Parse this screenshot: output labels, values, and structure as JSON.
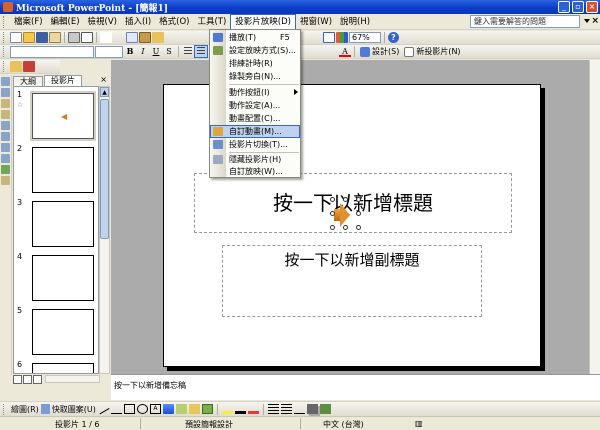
{
  "window": {
    "title": "Microsoft PowerPoint - [簡報1]",
    "minimize": "_",
    "restore": "▫",
    "close": "×"
  },
  "menubar": {
    "items": [
      "檔案(F)",
      "編輯(E)",
      "檢視(V)",
      "插入(I)",
      "格式(O)",
      "工具(T)",
      "投影片放映(D)",
      "視窗(W)",
      "說明(H)"
    ],
    "help_placeholder": "鍵入需要解答的問題",
    "close_doc": "×"
  },
  "toolbar_standard": {
    "zoom": "67%",
    "help": "?"
  },
  "toolbar_format": {
    "bold": "B",
    "italic": "I",
    "underline": "U",
    "shadow": "S",
    "design_label": "設計(S)",
    "new_slide_label": "新投影片(N)"
  },
  "dropdown": {
    "items": [
      {
        "label": "播放(T)",
        "shortcut": "F5"
      },
      {
        "label": "設定放映方式(S)...",
        "shortcut": ""
      },
      {
        "label": "排練計時(R)",
        "shortcut": ""
      },
      {
        "label": "錄製旁白(N)...",
        "shortcut": ""
      },
      {
        "label": "動作按鈕(I)",
        "shortcut": ""
      },
      {
        "label": "動作設定(A)...",
        "shortcut": ""
      },
      {
        "label": "動畫配置(C)...",
        "shortcut": ""
      },
      {
        "label": "自訂動畫(M)...",
        "shortcut": ""
      },
      {
        "label": "投影片切換(T)...",
        "shortcut": ""
      },
      {
        "label": "隱藏投影片(H)",
        "shortcut": ""
      },
      {
        "label": "自訂放映(W)...",
        "shortcut": ""
      }
    ],
    "highlighted_index": 7
  },
  "left_panel": {
    "tabs": [
      "大綱",
      "投影片"
    ],
    "active_tab": "投影片",
    "close": "×",
    "slides": [
      {
        "num": "1",
        "star": "☆"
      },
      {
        "num": "2"
      },
      {
        "num": "3"
      },
      {
        "num": "4"
      },
      {
        "num": "5"
      },
      {
        "num": "6"
      }
    ]
  },
  "slide": {
    "title_placeholder": "按一下以新增標題",
    "subtitle_placeholder": "按一下以新增副標題"
  },
  "notes": {
    "placeholder": "按一下以新增備忘稿"
  },
  "drawing_toolbar": {
    "draw_label": "繪圖(R)",
    "autoshapes_label": "快取圖案(U)",
    "textbox_glyph": "A"
  },
  "statusbar": {
    "slide_count": "投影片 1 / 6",
    "design": "預設簡報設計",
    "language": "中文 (台灣)"
  },
  "colors": {
    "titlebar": "#0a3cc8",
    "menu_highlight": "#c1d2ee",
    "menu_border": "#316ac5",
    "canvas_bg": "#ababab"
  }
}
